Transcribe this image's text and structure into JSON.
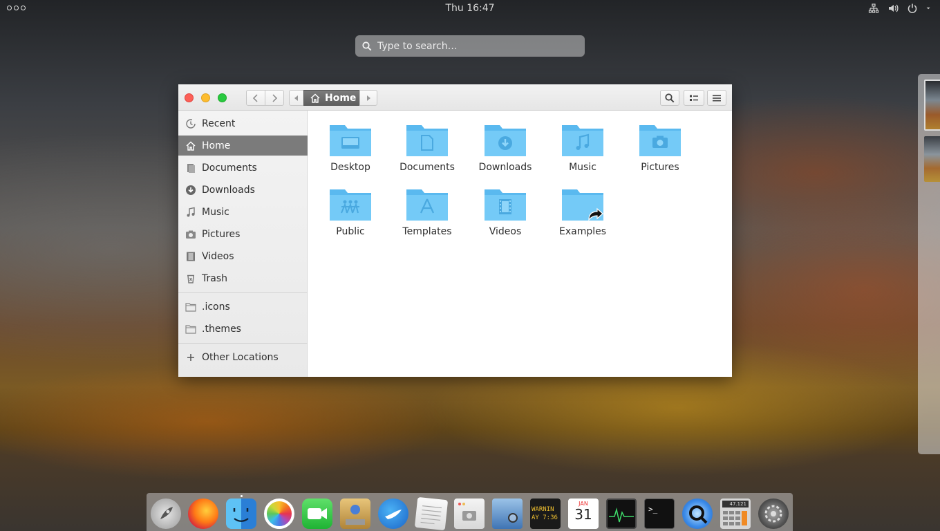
{
  "topbar": {
    "clock": "Thu 16:47",
    "icons": [
      "activities-icon",
      "network-icon",
      "volume-icon",
      "power-icon",
      "chevron-down-icon"
    ]
  },
  "search": {
    "placeholder": "Type to search…"
  },
  "window": {
    "path": {
      "current": "Home"
    },
    "toolbar_icons": [
      "back-icon",
      "forward-icon",
      "search-icon",
      "view-list-icon",
      "menu-icon"
    ],
    "traffic_lights": {
      "close": "#fc5f57",
      "minimize": "#fdbc2e",
      "maximize": "#29c940"
    }
  },
  "sidebar": {
    "items": [
      {
        "label": "Recent",
        "icon": "recent-icon"
      },
      {
        "label": "Home",
        "icon": "home-icon",
        "active": true
      },
      {
        "label": "Documents",
        "icon": "documents-icon"
      },
      {
        "label": "Downloads",
        "icon": "downloads-icon"
      },
      {
        "label": "Music",
        "icon": "music-icon"
      },
      {
        "label": "Pictures",
        "icon": "pictures-icon"
      },
      {
        "label": "Videos",
        "icon": "videos-icon"
      },
      {
        "label": "Trash",
        "icon": "trash-icon"
      }
    ],
    "bookmarks": [
      {
        "label": ".icons",
        "icon": "folder-icon"
      },
      {
        "label": ".themes",
        "icon": "folder-icon"
      }
    ],
    "other": {
      "label": "Other Locations",
      "icon": "plus-icon"
    }
  },
  "files": [
    {
      "name": "Desktop",
      "icon": "desktop-folder-icon"
    },
    {
      "name": "Documents",
      "icon": "documents-folder-icon"
    },
    {
      "name": "Downloads",
      "icon": "downloads-folder-icon"
    },
    {
      "name": "Music",
      "icon": "music-folder-icon"
    },
    {
      "name": "Pictures",
      "icon": "pictures-folder-icon"
    },
    {
      "name": "Public",
      "icon": "public-folder-icon"
    },
    {
      "name": "Templates",
      "icon": "templates-folder-icon"
    },
    {
      "name": "Videos",
      "icon": "videos-folder-icon"
    },
    {
      "name": "Examples",
      "icon": "examples-link-folder-icon"
    }
  ],
  "dock": {
    "apps": [
      "launchpad-icon",
      "firefox-icon",
      "finder-icon",
      "photos-icon",
      "facetime-icon",
      "disk-utility-icon",
      "mail-client-icon",
      "text-editor-icon",
      "screenshot-icon",
      "image-viewer-icon",
      "console-icon",
      "calendar-icon",
      "activity-monitor-icon",
      "terminal-icon",
      "quicktime-icon",
      "calculator-icon",
      "system-settings-icon"
    ],
    "console_text": "WARNIN\nAY 7:36",
    "calendar_month": "JAN",
    "calendar_day": "31",
    "terminal_prompt": ">_",
    "calculator_display": "47.121"
  },
  "colors": {
    "folder_blue": "#6ec6f5",
    "folder_blue_dark": "#4fb0e8",
    "sidebar_active": "#7b7b7b"
  }
}
